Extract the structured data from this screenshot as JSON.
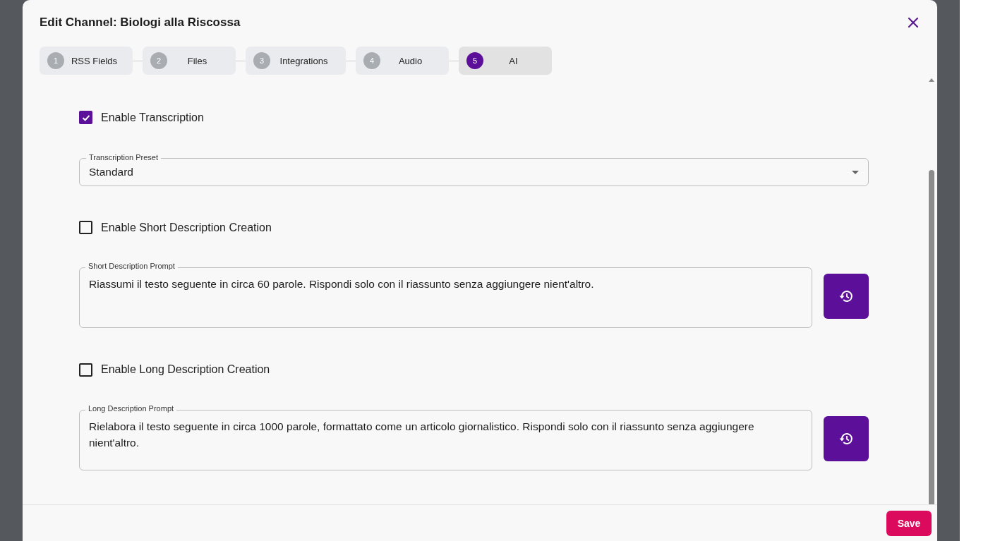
{
  "dialog": {
    "title": "Edit Channel: Biologi alla Riscossa"
  },
  "steps": [
    {
      "number": "1",
      "label": "RSS Fields",
      "selected": false
    },
    {
      "number": "2",
      "label": "Files",
      "selected": false
    },
    {
      "number": "3",
      "label": "Integrations",
      "selected": false
    },
    {
      "number": "4",
      "label": "Audio",
      "selected": false
    },
    {
      "number": "5",
      "label": "AI",
      "selected": true
    }
  ],
  "sections": [
    {
      "kind": "checkbox",
      "label": "Enable Transcription",
      "checked": true
    },
    {
      "kind": "select",
      "label": "Transcription Preset",
      "value": "Standard"
    },
    {
      "kind": "checkbox",
      "label": "Enable Short Description Creation",
      "checked": false
    },
    {
      "kind": "prompt",
      "label": "Short Description Prompt",
      "value": "Riassumi il testo seguente in circa 60 parole. Rispondi solo con il riassunto senza aggiungere nient'altro."
    },
    {
      "kind": "checkbox",
      "label": "Enable Long Description Creation",
      "checked": false
    },
    {
      "kind": "prompt",
      "label": "Long Description Prompt",
      "value": "Rielabora il testo seguente in circa 1000 parole, formattato come un articolo giornalistico. Rispondi solo con il riassunto senza aggiungere nient'altro."
    }
  ],
  "footer": {
    "save": "Save"
  }
}
